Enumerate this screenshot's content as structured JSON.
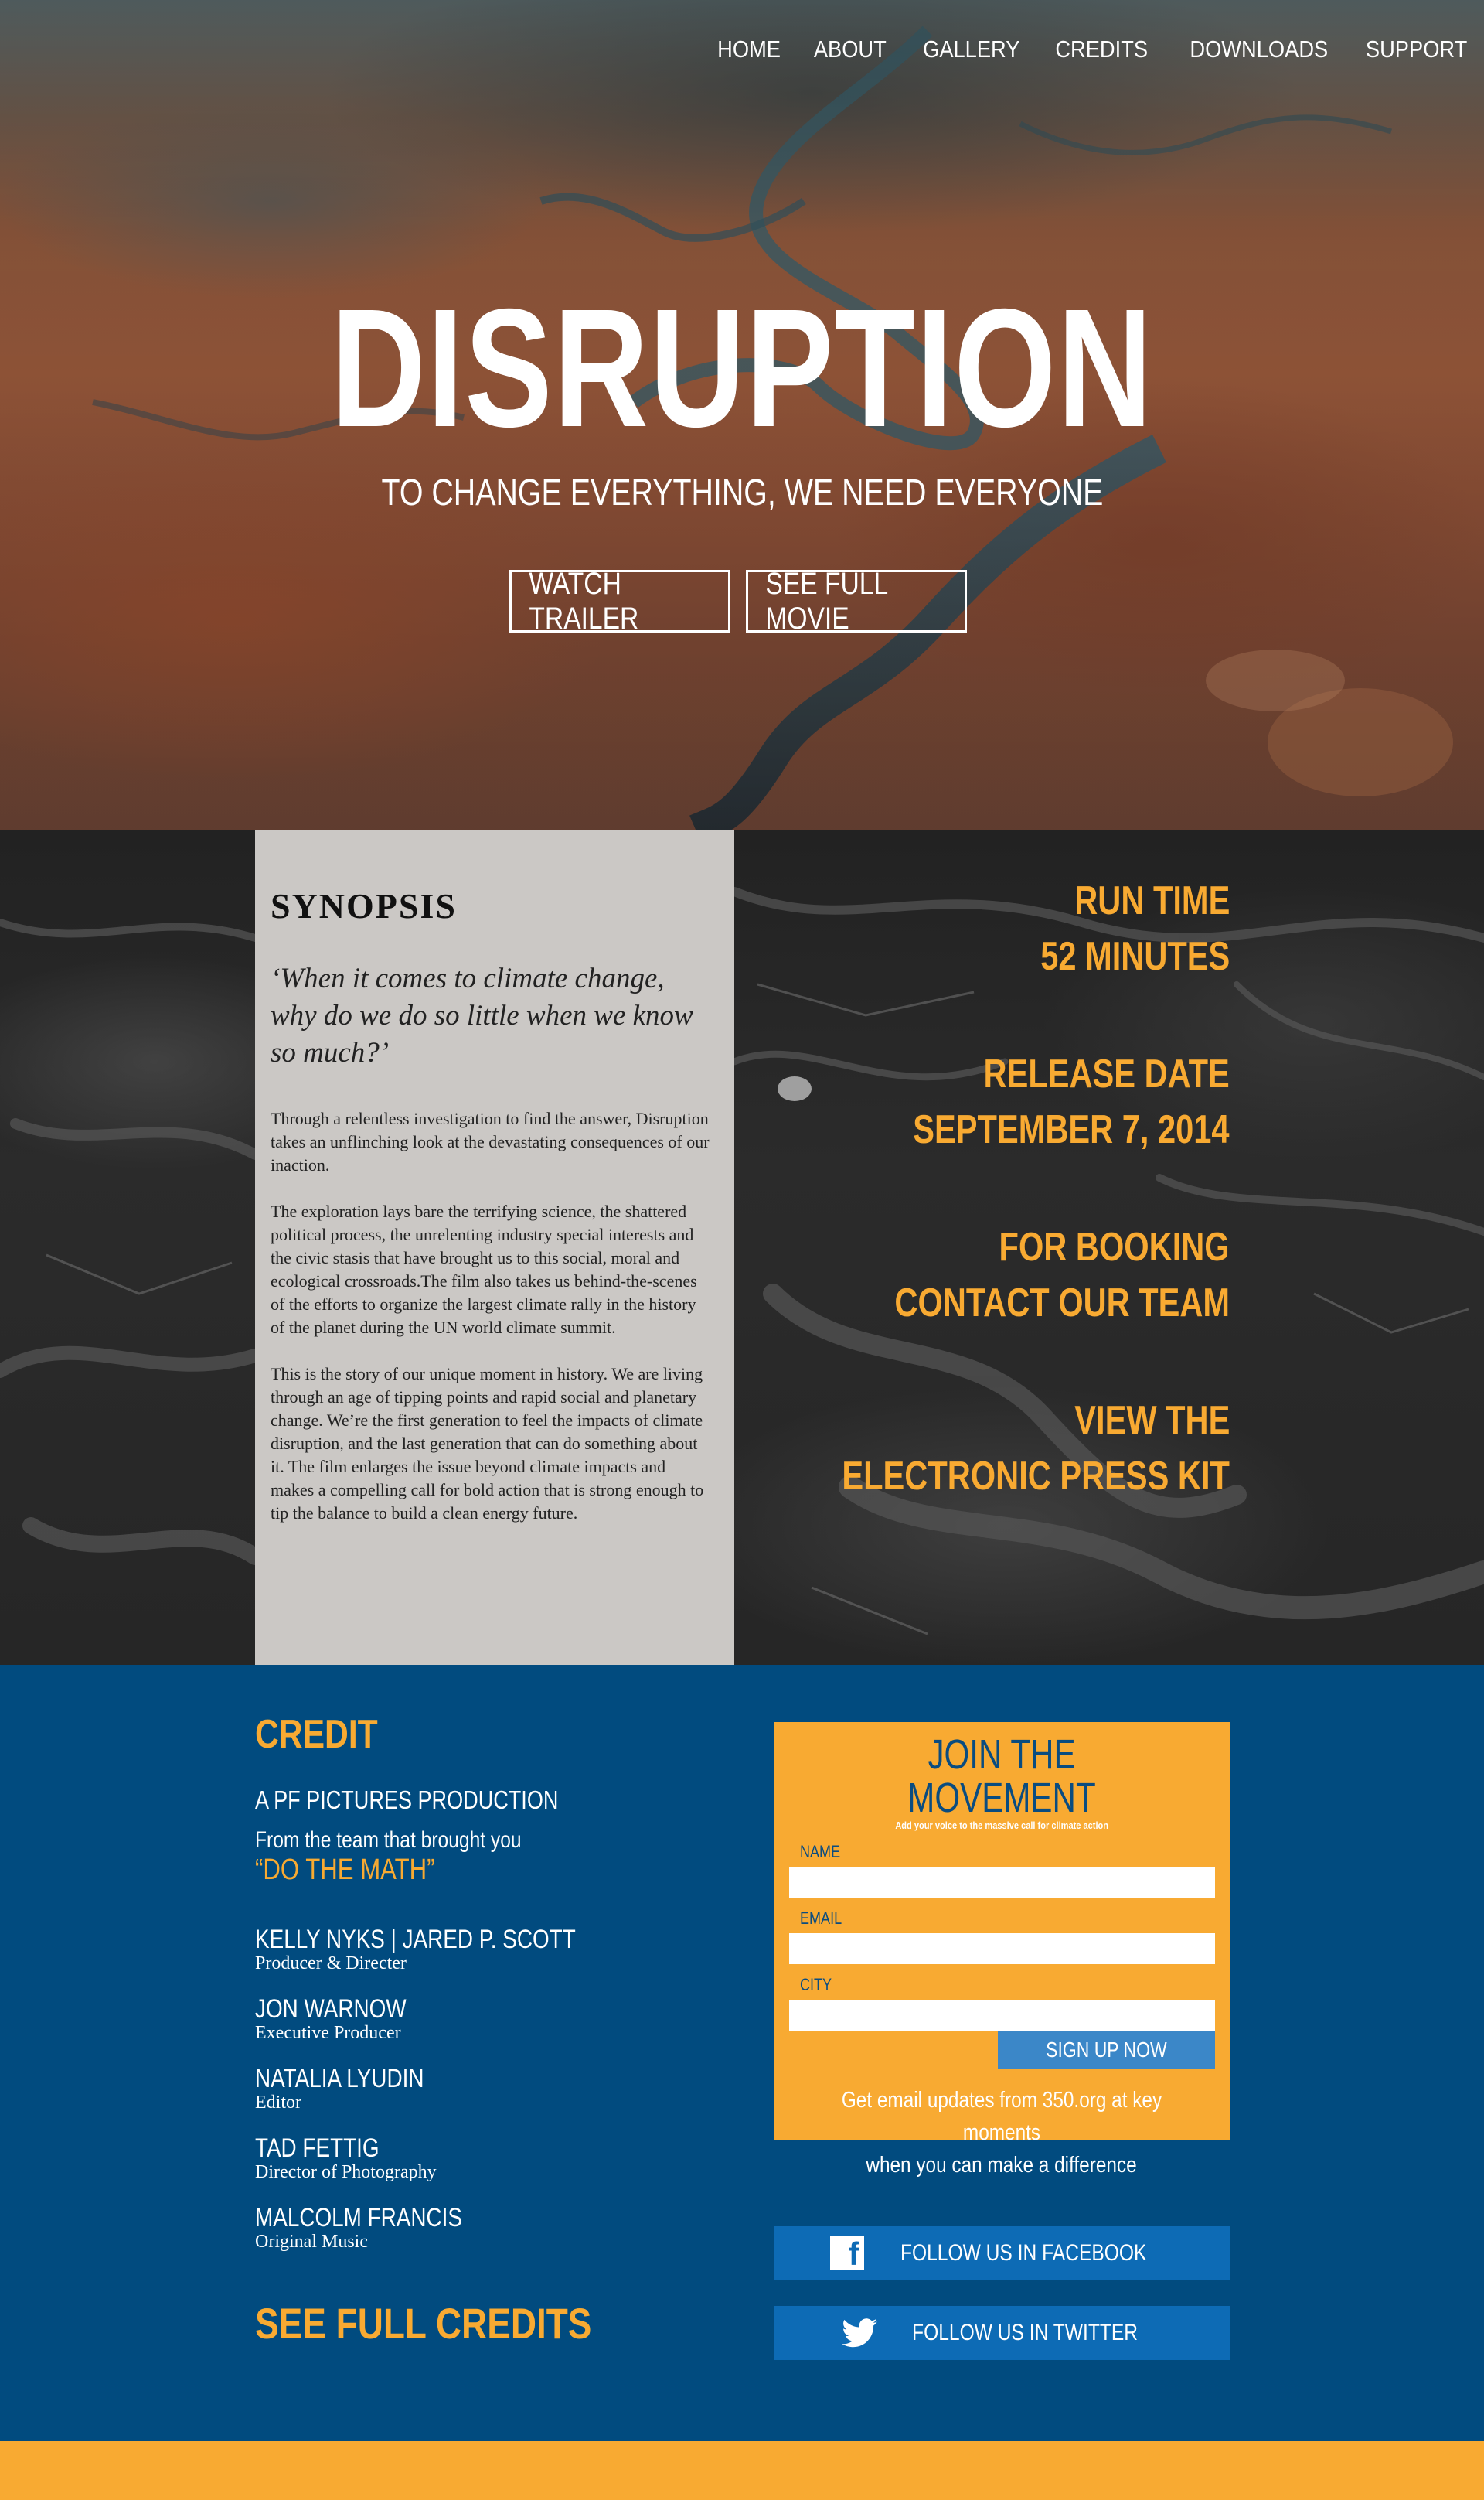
{
  "nav": {
    "items": [
      "HOME",
      "ABOUT",
      "GALLERY",
      "CREDITS",
      "DOWNLOADS",
      "SUPPORT"
    ]
  },
  "hero": {
    "title": "DISRUPTION",
    "tagline": "TO CHANGE EVERYTHING, WE NEED EVERYONE",
    "watch_trailer": "WATCH TRAILER",
    "see_full_movie": "SEE FULL MOVIE"
  },
  "synopsis": {
    "heading": "SYNOPSIS",
    "quote": "‘When it comes to climate change, why do we do so little when we know so much?’",
    "paragraphs": [
      "Through a relentless investigation to find the answer, Disruption takes an unflinching look at the devastating consequences of our inaction.",
      "The exploration lays bare the terrifying science, the shattered political process, the unrelenting industry special interests and the civic stasis that have brought us to this social, moral and ecological crossroads.The film also takes us behind-the-scenes of the efforts to organize the largest climate rally in the history of the planet during the UN world climate summit.",
      "This is the story of our unique moment in history. We are living through an age of tipping points and rapid social and planetary change. We’re the first generation to feel the impacts of climate disruption, and the last generation that can do something about it. The film enlarges the issue beyond climate impacts and makes a compelling call for bold action that is strong enough to tip the balance to build a clean energy future."
    ]
  },
  "facts": {
    "run_time_label": "RUN TIME",
    "run_time_value": "52 MINUTES",
    "release_label": "RELEASE DATE",
    "release_value": "SEPTEMBER 7, 2014",
    "booking_label": "FOR BOOKING",
    "booking_value": "CONTACT OUR TEAM",
    "press_label": "VIEW THE",
    "press_value": "ELECTRONIC PRESS KIT"
  },
  "credit": {
    "title": "CREDIT",
    "production": "A PF PICTURES PRODUCTION",
    "team_prefix": "From the team that brought you",
    "team_highlight": "“DO THE MATH”",
    "people": [
      {
        "name": "KELLY NYKS | JARED P. SCOTT",
        "role": "Producer & Directer"
      },
      {
        "name": "JON WARNOW",
        "role": "Executive Producer"
      },
      {
        "name": "NATALIA LYUDIN",
        "role": "Editor"
      },
      {
        "name": "TAD FETTIG",
        "role": "Director of Photography"
      },
      {
        "name": "MALCOLM FRANCIS",
        "role": "Original Music"
      }
    ],
    "see_full": "SEE FULL CREDITS"
  },
  "join": {
    "title": "JOIN THE MOVEMENT",
    "subtitle": "Add your voice to the massive call for climate action",
    "name_label": "NAME",
    "email_label": "EMAIL",
    "city_label": "CITY",
    "name_value": "",
    "email_value": "",
    "city_value": "",
    "signup": "SIGN UP NOW",
    "note_line1": "Get email updates from 350.org at key moments",
    "note_line2": "when you can make a difference"
  },
  "social": {
    "facebook": "FOLLOW US IN FACEBOOK",
    "twitter": "FOLLOW US IN TWITTER"
  },
  "colors": {
    "accent": "#f8aa32",
    "navy": "#014b7f",
    "social_blue": "#0d6bb5",
    "signup_blue": "#3b87c8",
    "synopsis_panel": "#cbc8c5"
  },
  "icons": [
    "facebook-icon",
    "twitter-icon"
  ]
}
